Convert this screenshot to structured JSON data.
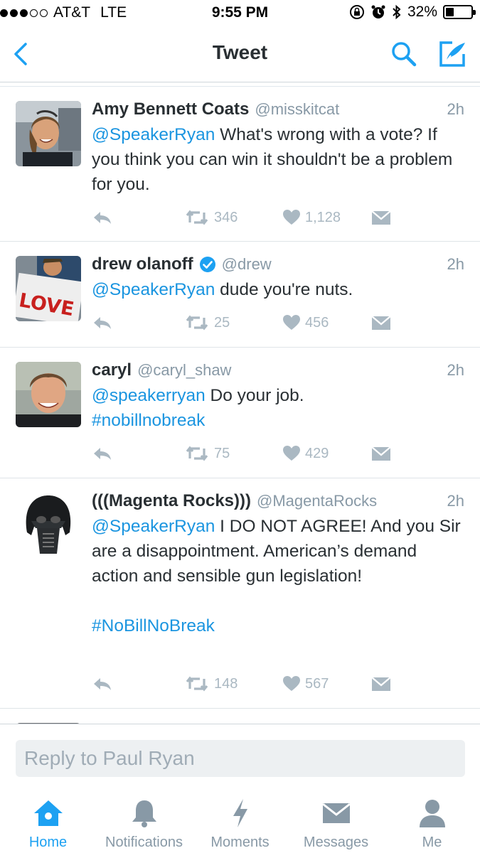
{
  "status_bar": {
    "carrier": "AT&T",
    "network": "LTE",
    "time": "9:55 PM",
    "battery": "32%",
    "battery_level": 0.32,
    "signal_bars": 3,
    "signal_total": 5
  },
  "nav": {
    "title": "Tweet",
    "accent_color": "#1da1f2",
    "icons": [
      "chevron-left-icon",
      "search-icon",
      "compose-icon"
    ]
  },
  "tweets": [
    {
      "name": "Amy Bennett Coats",
      "handle": "@misskitcat",
      "time": "2h",
      "verified": false,
      "text_mention": "@SpeakerRyan",
      "text_body": " What's wrong with a vote? If you think you can win it shouldn't be a problem for you.",
      "retweets": "346",
      "likes": "1,128"
    },
    {
      "name": "drew olanoff",
      "handle": "@drew",
      "time": "2h",
      "verified": true,
      "text_mention": "@SpeakerRyan",
      "text_body": " dude you're nuts.",
      "retweets": "25",
      "likes": "456",
      "avatar_sign": "LOVE"
    },
    {
      "name": "caryl",
      "handle": "@caryl_shaw",
      "time": "2h",
      "verified": false,
      "text_mention": "@speakerryan",
      "text_body": " Do your job.",
      "hashtag": "#nobillnobreak",
      "retweets": "75",
      "likes": "429"
    },
    {
      "name": "(((Magenta Rocks)))",
      "handle": "@MagentaRocks",
      "time": "2h",
      "verified": false,
      "text_mention": "@SpeakerRyan",
      "text_body": " I DO NOT AGREE! And you Sir are a disappointment. American’s demand action and sensible gun legislation!",
      "hashtag": "#NoBillNoBreak",
      "retweets": "148",
      "likes": "567"
    }
  ],
  "reply": {
    "placeholder": "Reply to Paul Ryan"
  },
  "tabs": [
    {
      "label": "Home",
      "icon": "home-icon",
      "active": true
    },
    {
      "label": "Notifications",
      "icon": "bell-icon",
      "active": false
    },
    {
      "label": "Moments",
      "icon": "lightning-icon",
      "active": false
    },
    {
      "label": "Messages",
      "icon": "envelope-icon",
      "active": false
    },
    {
      "label": "Me",
      "icon": "person-icon",
      "active": false
    }
  ]
}
